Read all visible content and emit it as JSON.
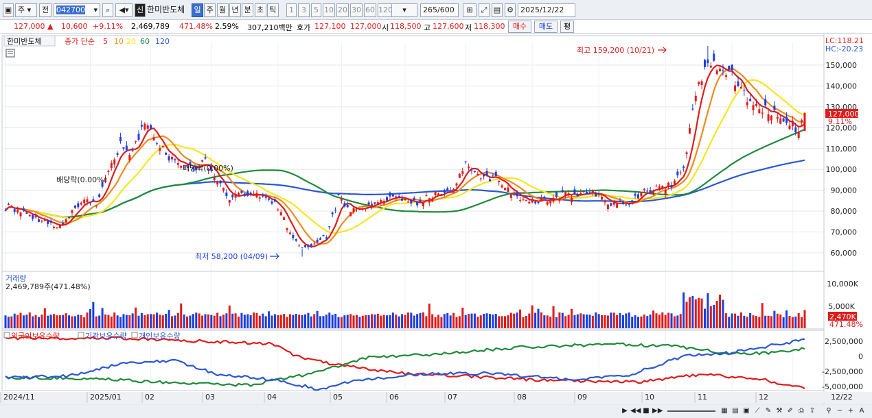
{
  "toolbar": {
    "period_value": "주",
    "prev_label": "전",
    "stock_code": "042700",
    "credit_badge": "신",
    "stock_name": "한미반도체",
    "period_tabs": [
      "일",
      "주",
      "월",
      "년",
      "분",
      "초",
      "틱"
    ],
    "active_tab": "일",
    "interval_buttons": [
      "1",
      "3",
      "5",
      "10",
      "20",
      "30",
      "60",
      "120"
    ],
    "count_value": "265",
    "count_total": "/600",
    "date_value": "2025/12/22"
  },
  "infobar": {
    "price": "127,000",
    "change": "10,600",
    "change_pct": "+9.11%",
    "volume": "2,469,789",
    "volume_pct": "471.48%",
    "turnover": "2.59%",
    "amount": "307,210백만",
    "ask_label": "호가",
    "ask_price": "127,100",
    "bid_price": "127,000",
    "open_label": "시",
    "open": "118,500",
    "high_label": "고",
    "high": "127,600",
    "low_label": "저",
    "low": "118,300",
    "buy_label": "매수",
    "sell_label": "매도",
    "avg_label": "평"
  },
  "price_panel": {
    "title": "한미반도체",
    "ma_title": "종가 단순",
    "ma_periods": [
      "5",
      "10",
      "20",
      "60",
      "120"
    ],
    "lc_label": "LC:118.21",
    "hc_label": "HC:-20.23",
    "current_price_tag": "127,000",
    "current_pct_tag": "9.11%",
    "high_annotation": "최고 159,200 (10/21)",
    "low_annotation": "최저 58,200 (04/09)",
    "dividend_label_1": "배당락(0.00%)",
    "dividend_label_2": "배당락(0.00%)",
    "y_ticks": [
      "150,000",
      "140,000",
      "130,000",
      "120,000",
      "110,000",
      "100,000",
      "90,000",
      "80,000",
      "70,000",
      "60,000"
    ]
  },
  "volume_panel": {
    "title": "거래량",
    "value_label": "2,469,789주(471.48%)",
    "y_ticks": [
      "10,000K",
      "5,000K"
    ],
    "current_tag": "2,470K",
    "current_pct": "471.48%"
  },
  "holding_panel": {
    "legend": [
      "외국인보유수량",
      "기관보유수량",
      "개인보유수량"
    ],
    "y_ticks": [
      "2,500,000",
      "0",
      "-2,500,000",
      "-5,000,000"
    ]
  },
  "x_axis": {
    "labels": [
      "2024/11",
      "2025/01",
      "02",
      "03",
      "04",
      "05",
      "06",
      "07",
      "08",
      "09",
      "10",
      "11",
      "12",
      "12/22"
    ]
  },
  "colors": {
    "up": "#e01b1b",
    "down": "#1b3ee0",
    "ma5": "#e01b1b",
    "ma10": "#f08a1c",
    "ma20": "#f5e61e",
    "ma60": "#1f8a3a",
    "ma120": "#2b57d6",
    "foreign": "#e01b1b",
    "institution": "#1f8a3a",
    "individual": "#2b57d6"
  },
  "chart_data": {
    "type": "candlestick",
    "series_keypoints": [
      {
        "date": "2024/11",
        "close": 83000
      },
      {
        "date": "2024/12",
        "close": 72000
      },
      {
        "date": "2025/01",
        "close": 115000
      },
      {
        "date": "2025/01",
        "close": 122000
      },
      {
        "date": "2025/02",
        "close": 100000
      },
      {
        "date": "2025/03",
        "close": 86000
      },
      {
        "date": "2025/04/09",
        "close": 58200
      },
      {
        "date": "2025/05",
        "close": 84000
      },
      {
        "date": "2025/06",
        "close": 86000
      },
      {
        "date": "2025/07",
        "close": 96000
      },
      {
        "date": "2025/08",
        "close": 86000
      },
      {
        "date": "2025/09",
        "close": 84000
      },
      {
        "date": "2025/10/21",
        "close": 159200
      },
      {
        "date": "2025/11",
        "close": 125000
      },
      {
        "date": "2025/12/22",
        "close": 127000
      }
    ],
    "ylim": [
      55000,
      160000
    ]
  }
}
